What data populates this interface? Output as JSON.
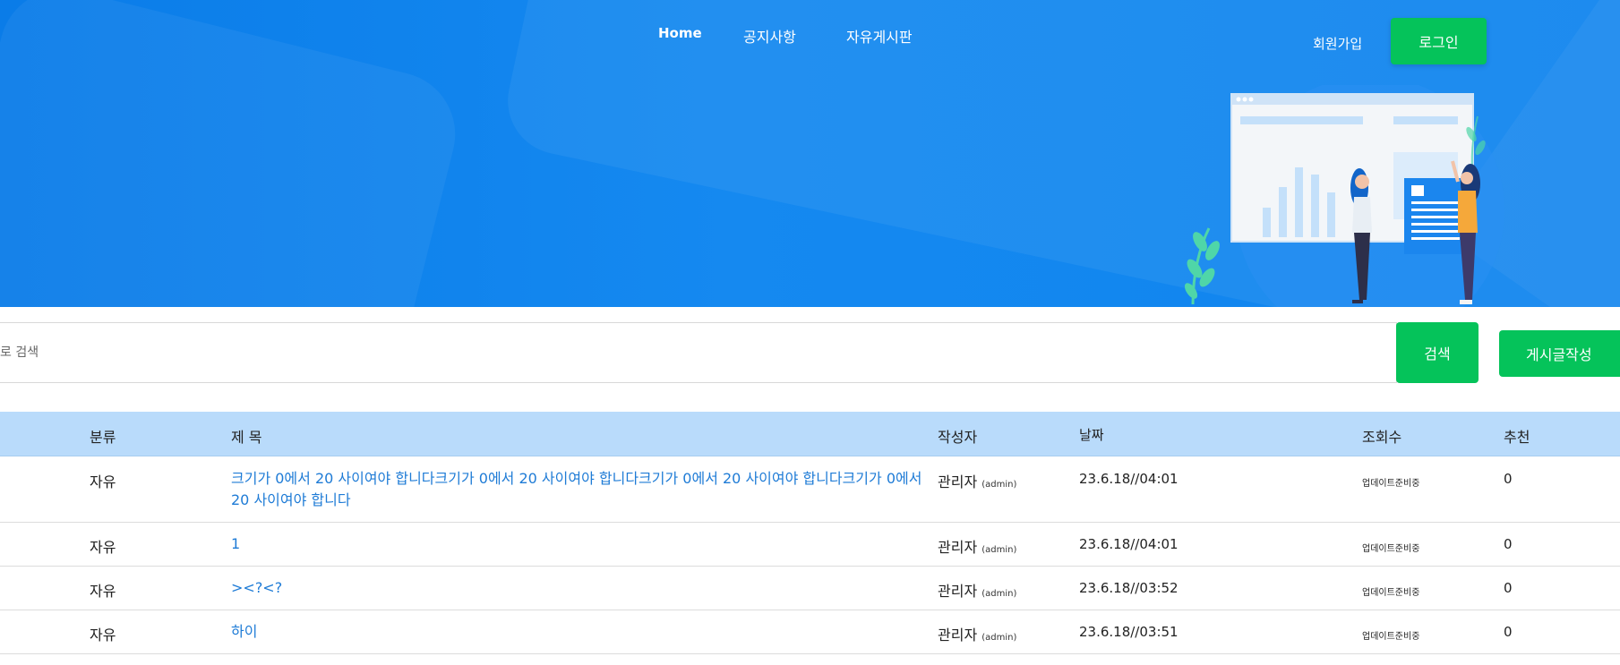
{
  "nav": {
    "home": "Home",
    "notice": "공지사항",
    "free_board": "자유게시판"
  },
  "auth": {
    "signup": "회원가입",
    "login": "로그인"
  },
  "search": {
    "placeholder": "로 검색",
    "button": "검색",
    "write_button": "게시글작성"
  },
  "table": {
    "headers": {
      "category": "분류",
      "title": "제 목",
      "author": "작성자",
      "date": "날짜",
      "views": "조회수",
      "recommend": "추천"
    },
    "rows": [
      {
        "category": "자유",
        "title": "크기가 0에서 20 사이여야 합니다크기가 0에서 20 사이여야 합니다크기가 0에서 20 사이여야 합니다크기가 0에서 20 사이여야 합니다",
        "author": "관리자",
        "author_id": "(admin)",
        "date": "23.6.18//04:01",
        "views": "업데이트준비중",
        "recommend": "0"
      },
      {
        "category": "자유",
        "title": "1",
        "author": "관리자",
        "author_id": "(admin)",
        "date": "23.6.18//04:01",
        "views": "업데이트준비중",
        "recommend": "0"
      },
      {
        "category": "자유",
        "title": "><?<?",
        "author": "관리자",
        "author_id": "(admin)",
        "date": "23.6.18//03:52",
        "views": "업데이트준비중",
        "recommend": "0"
      },
      {
        "category": "자유",
        "title": "하이",
        "author": "관리자",
        "author_id": "(admin)",
        "date": "23.6.18//03:51",
        "views": "업데이트준비중",
        "recommend": "0"
      }
    ]
  },
  "colors": {
    "hero_blue": "#0f84ee",
    "header_row": "#b9dbfb",
    "button_green": "#05c35a",
    "link_blue": "#1e7bd6"
  }
}
